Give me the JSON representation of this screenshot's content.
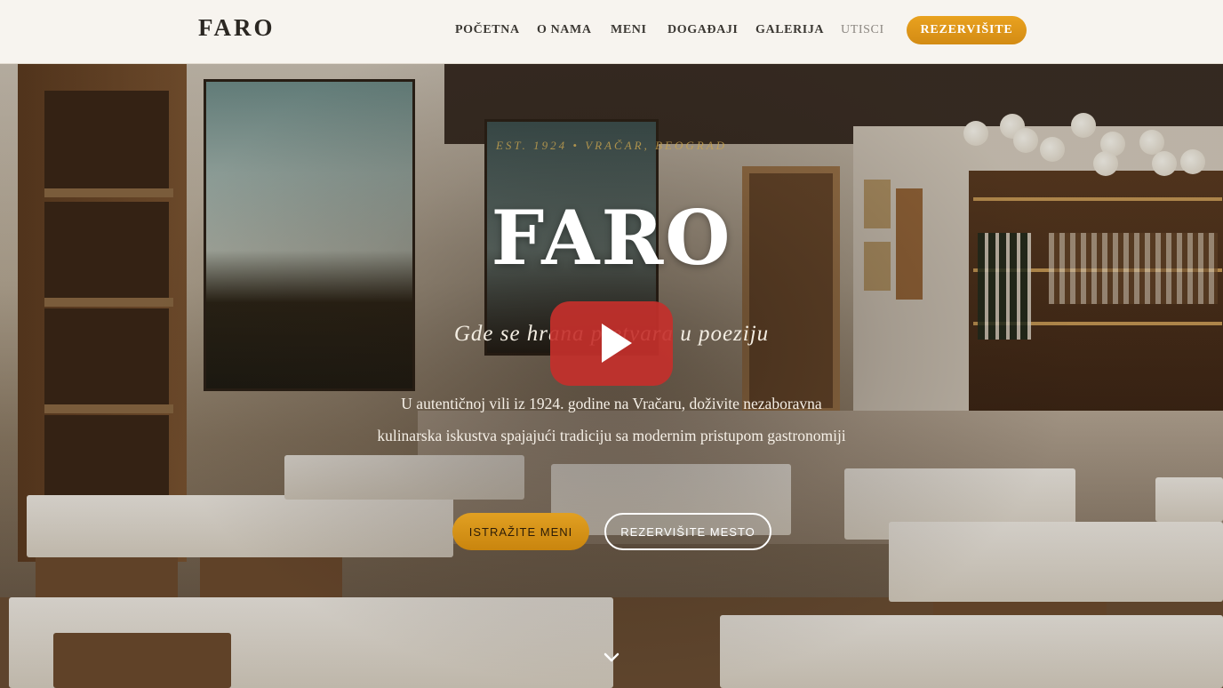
{
  "brand": {
    "logo": "FARO"
  },
  "nav": {
    "items": [
      {
        "label": "POČETNA",
        "muted": false
      },
      {
        "label": "O NAMA",
        "muted": false
      },
      {
        "label": "MENI",
        "muted": false
      },
      {
        "label": "DOGAĐAJI",
        "muted": false
      },
      {
        "label": "GALERIJA",
        "muted": false
      },
      {
        "label": "UTISCI",
        "muted": true
      }
    ],
    "cta_label": "REZERVIŠITE"
  },
  "hero": {
    "eyebrow": "EST. 1924 • VRAČAR, BEOGRAD",
    "title": "FARO",
    "tagline": "Gde se hrana pretvara u poeziju",
    "description": "U autentičnoj vili iz 1924. godine na Vračaru, doživite nezaboravna kulinarska iskustva spajajući tradiciju sa modernim pristupom gastronomiji",
    "primary_button": "ISTRAŽITE MENI",
    "secondary_button": "REZERVIŠITE MESTO",
    "video_icon": "play-icon",
    "scroll_icon": "chevron-down-icon"
  },
  "colors": {
    "accent": "#e1a022",
    "nav_bg": "#f7f4ef",
    "play_red": "#c4302b"
  }
}
